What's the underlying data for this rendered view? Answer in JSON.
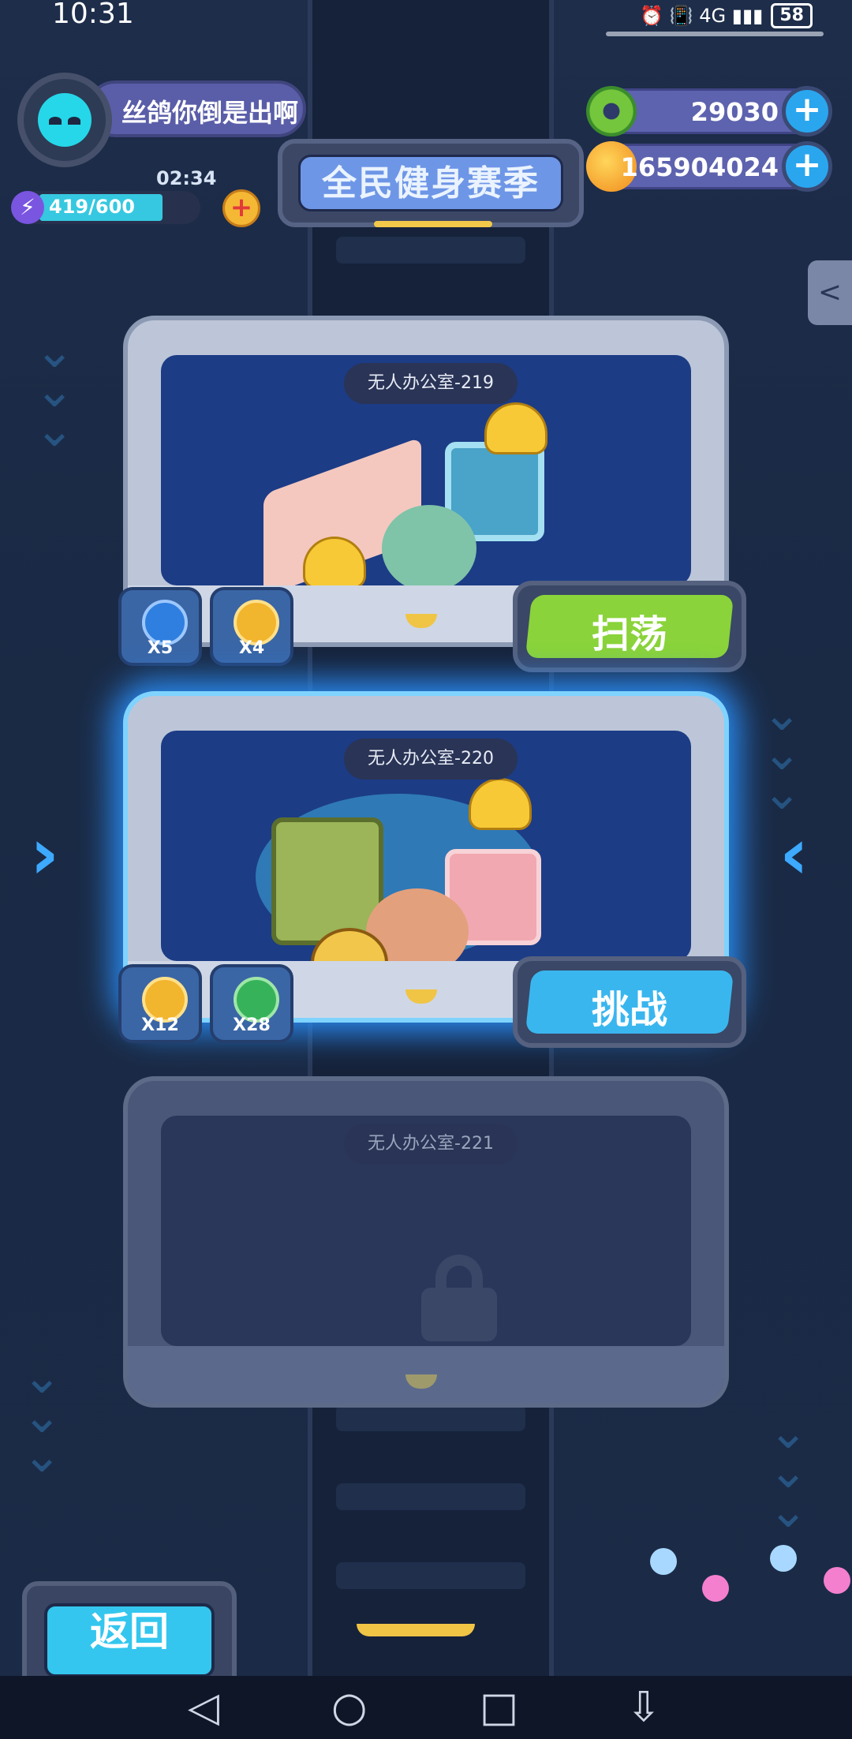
{
  "status_bar": {
    "time": "10:31",
    "signal_icons": "⏰ 📳 4G ▮▮▮",
    "battery": "58"
  },
  "player": {
    "name": "丝鸽你倒是出啊",
    "timer": "02:34",
    "energy": "419/600",
    "energy_fraction": 0.698
  },
  "season_title": "全民健身赛季",
  "currencies": {
    "donut": "29030",
    "coins": "165904024"
  },
  "levels": [
    {
      "label": "无人办公室-219",
      "rewards": [
        "X5",
        "X4"
      ],
      "action": "扫荡",
      "action_color": "#8ad33a"
    },
    {
      "label": "无人办公室-220",
      "rewards": [
        "X12",
        "X28"
      ],
      "action": "挑战",
      "action_color": "#3ab6ef"
    },
    {
      "label": "无人办公室-221",
      "locked": true
    }
  ],
  "back_label": "返回",
  "nav": {
    "back": "◁",
    "home": "○",
    "recents": "□",
    "menu": "⇩"
  }
}
